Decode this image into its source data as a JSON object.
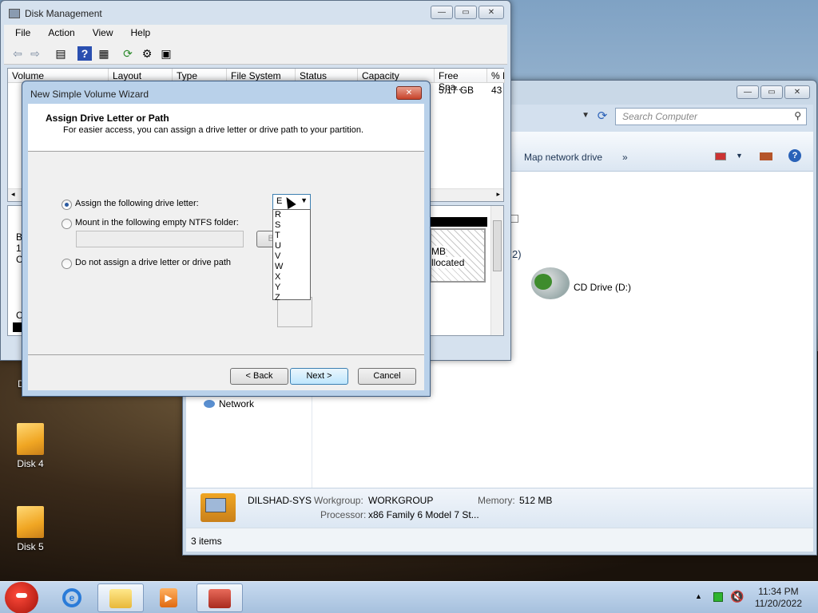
{
  "desktop": {
    "icons": [
      {
        "label": "Disk 4"
      },
      {
        "label": "Disk 5"
      }
    ],
    "partial_icon_letter": "D"
  },
  "explorer": {
    "search_placeholder": "Search Computer",
    "cmd_map_network": "Map network drive",
    "cmd_more": "»",
    "group_partial": "2)",
    "cd_drive_label": "CD Drive (D:)",
    "nav_network": "Network",
    "details": {
      "computer_name": "DILSHAD-SYS",
      "workgroup_label": "Workgroup:",
      "workgroup_value": "WORKGROUP",
      "memory_label": "Memory:",
      "memory_value": "512 MB",
      "processor_label": "Processor:",
      "processor_value": "x86 Family 6 Model 7 St..."
    },
    "status": "3 items"
  },
  "disk_management": {
    "title": "Disk Management",
    "menu": [
      "File",
      "Action",
      "View",
      "Help"
    ],
    "columns": [
      "Volume",
      "Layout",
      "Type",
      "File System",
      "Status",
      "Capacity",
      "Free Spa...",
      "% F"
    ],
    "row_free_space": "5.17 GB",
    "row_percent": "43",
    "graph_partial_text": [
      "B",
      "1",
      "C",
      "C"
    ],
    "unalloc_size_partial": "MB",
    "unalloc_label_partial": "llocated"
  },
  "wizard": {
    "title": "New Simple Volume Wizard",
    "heading": "Assign Drive Letter or Path",
    "subheading": "For easier access, you can assign a drive letter or drive path to your partition.",
    "option_assign": "Assign the following drive letter:",
    "option_mount": "Mount in the following empty NTFS folder:",
    "option_none": "Do not assign a drive letter or drive path",
    "browse_partial": "Br",
    "selected_letter": "E",
    "letters": [
      "R",
      "S",
      "T",
      "U",
      "V",
      "W",
      "X",
      "Y",
      "Z"
    ],
    "back_label": "< Back",
    "next_label": "Next >",
    "cancel_label": "Cancel"
  },
  "taskbar": {
    "time": "11:34 PM",
    "date": "11/20/2022"
  },
  "colors": {
    "accent": "#3c7fb1",
    "window_frame": "#cfdbe8",
    "taskbar": "#b5cde6"
  }
}
